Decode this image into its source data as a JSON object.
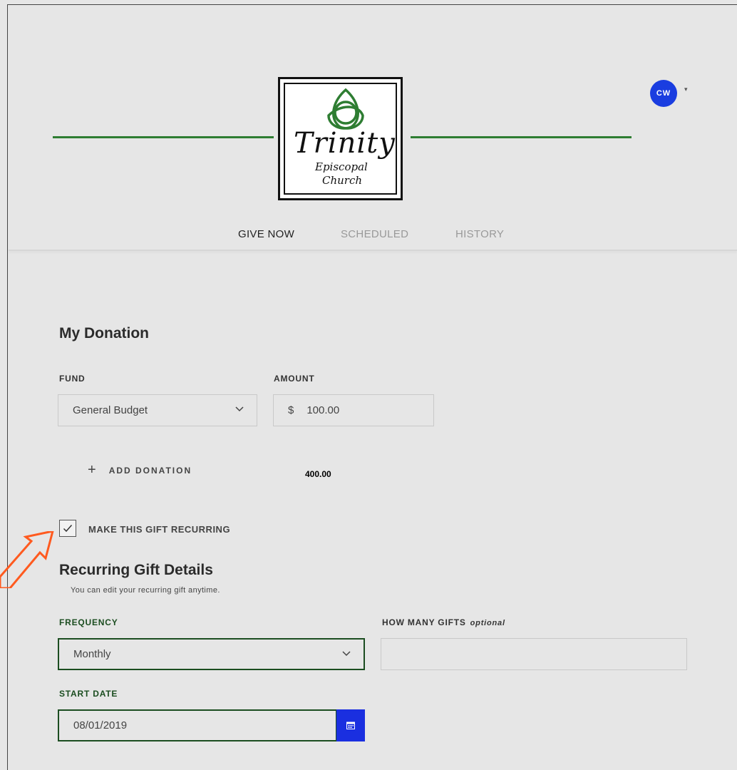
{
  "logo": {
    "line1": "Trinity",
    "line2": "Episcopal",
    "line3": "Church"
  },
  "user": {
    "initials": "CW",
    "caret": "▾"
  },
  "tabs": {
    "give_now": "GIVE NOW",
    "scheduled": "SCHEDULED",
    "history": "HISTORY"
  },
  "donation": {
    "title": "My Donation",
    "fund_label": "FUND",
    "fund_value": "General Budget",
    "amount_label": "AMOUNT",
    "currency": "$",
    "amount_value": "100.00",
    "add_label": "ADD DONATION",
    "add_icon": "+",
    "total": "400.00"
  },
  "recurring": {
    "checkbox_label": "MAKE THIS GIFT RECURRING",
    "checked": true,
    "title": "Recurring Gift Details",
    "subtitle": "You can edit your recurring gift anytime.",
    "frequency_label": "FREQUENCY",
    "frequency_value": "Monthly",
    "how_many_label": "HOW MANY GIFTS",
    "how_many_optional": "optional",
    "how_many_value": "",
    "start_label": "START DATE",
    "start_value": "08/01/2019"
  },
  "colors": {
    "accent_green": "#1b4d20",
    "header_line_green": "#2e7d32",
    "brand_blue": "#1a2fe0",
    "arrow_orange": "#ff5a1f"
  },
  "icons": {
    "chevron": "chevron-down-icon",
    "calendar": "calendar-icon",
    "check": "check-icon",
    "plus": "plus-icon",
    "logo_knot": "triquetra-icon",
    "annotation": "arrow-annotation"
  }
}
